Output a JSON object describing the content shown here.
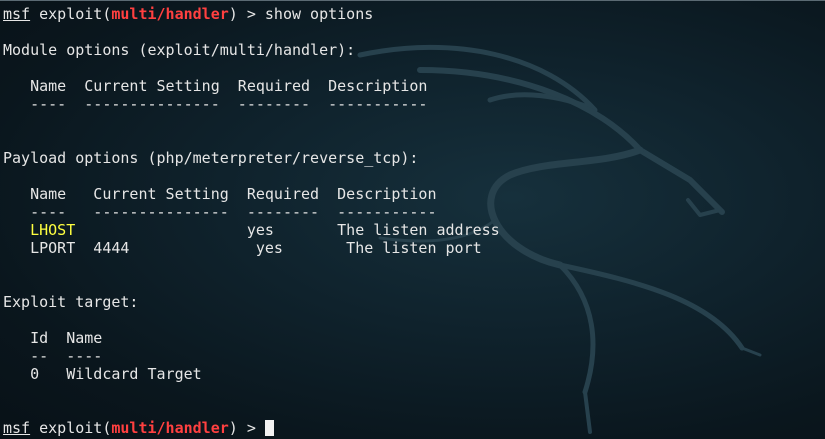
{
  "prompt": {
    "msf": "msf",
    "exploit_word": " exploit(",
    "module": "multi/handler",
    "close": ") > "
  },
  "command": "show options",
  "module_options": {
    "heading": "Module options (exploit/multi/handler):",
    "columns_line": "   Name  Current Setting  Required  Description",
    "divider_line": "   ----  ---------------  --------  -----------"
  },
  "payload_options": {
    "heading": "Payload options (php/meterpreter/reverse_tcp):",
    "columns_line": "   Name   Current Setting  Required  Description",
    "divider_line": "   ----   ---------------  --------  -----------",
    "rows": [
      {
        "indent": "   ",
        "name": "LHOST",
        "rest": "                   yes       The listen address"
      },
      {
        "indent": "   ",
        "name": "LPORT",
        "rest": "  4444              yes       The listen port"
      }
    ]
  },
  "exploit_target": {
    "heading": "Exploit target:",
    "columns_line": "   Id  Name",
    "divider_line": "   --  ----",
    "row": "   0   Wildcard Target"
  },
  "theme": {
    "background": "#0f222c",
    "text": "#e6e6e6",
    "module_color": "#ff4040",
    "highlight_option": "#ffff40"
  },
  "wallpaper_icon": "kali-dragon-icon"
}
